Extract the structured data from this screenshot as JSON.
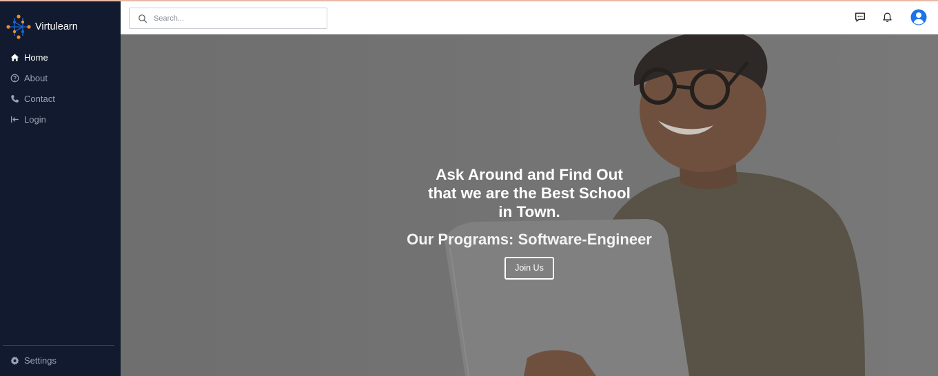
{
  "app": {
    "name": "Virtulearn"
  },
  "sidebar": {
    "items": [
      {
        "label": "Home",
        "icon": "home-icon",
        "active": true
      },
      {
        "label": "About",
        "icon": "question-circle-icon",
        "active": false
      },
      {
        "label": "Contact",
        "icon": "phone-icon",
        "active": false
      },
      {
        "label": "Login",
        "icon": "login-icon",
        "active": false
      }
    ],
    "settings": {
      "label": "Settings",
      "icon": "gear-icon"
    }
  },
  "header": {
    "search": {
      "placeholder": "Search...",
      "value": ""
    },
    "icons": [
      "chat-icon",
      "bell-icon",
      "user-avatar-icon"
    ]
  },
  "hero": {
    "headline": "Ask Around and Find Out that we are the Best School in Town.",
    "programs": "Our Programs: Software-Engineer",
    "cta_label": "Join Us"
  },
  "colors": {
    "sidebar_bg": "#111a2e",
    "brand_orange": "#f28c28",
    "brand_blue": "#1e63c9",
    "avatar_blue": "#1a73e8"
  }
}
